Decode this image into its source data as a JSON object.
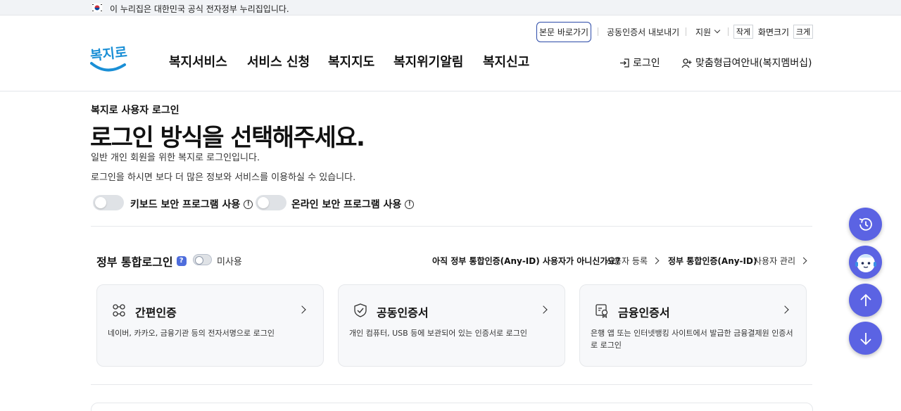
{
  "gov_bar": {
    "text": "이 누리집은 대한민국 공식 전자정부 누리집입니다."
  },
  "util": {
    "skip_label": "본문 바로가기",
    "cert_label": "공동인증서 내보내기",
    "support_label": "지원",
    "font_small": "작게",
    "font_size_label": "화면크기",
    "font_big": "크게"
  },
  "logo": {
    "text": "복지로"
  },
  "nav": [
    "복지서비스",
    "서비스 신청",
    "복지지도",
    "복지위기알림",
    "복지신고"
  ],
  "header_actions": {
    "login": "로그인",
    "member": "맞춤형급여안내(복지멤버십)"
  },
  "page": {
    "crumb": "복지로 사용자 로그인",
    "title": "로그인 방식을 선택해주세요.",
    "desc1": "일반 개인 회원을 위한 복지로 로그인입니다.",
    "desc2": "로그인을 하시면 보다 더 많은 정보와 서비스를 이용하실 수 있습니다."
  },
  "toggles": [
    {
      "label": "키보드 보안 프로그램 사용"
    },
    {
      "label": "온라인 보안 프로그램 사용"
    }
  ],
  "gov_login": {
    "title": "정부 통합로그인",
    "help": "?",
    "toggle_state": "미사용",
    "question": "아직 정부 통합인증(Any-ID) 사용자가 아니신가요?",
    "register": "사용자 등록",
    "any_id": "정부 통합인증(Any-ID)",
    "manage": "사용자 관리"
  },
  "cards": [
    {
      "icon": "simple-auth-icon",
      "title": "간편인증",
      "desc": "네이버, 카카오, 금융기관 등의 전자서명으로 로그인"
    },
    {
      "icon": "shield-check-icon",
      "title": "공동인증서",
      "desc": "개인 컴퓨터, USB 등에 보관되어 있는 인증서로 로그인"
    },
    {
      "icon": "financial-cert-icon",
      "title": "금융인증서",
      "desc": "은행 앱 또는 인터넷뱅킹 사이트에서 발급한 금융결제원 인증서로 로그인"
    }
  ],
  "floating": [
    "history-icon",
    "chatbot-icon",
    "arrow-up-icon",
    "arrow-down-icon"
  ],
  "colors": {
    "accent": "#5b63e3",
    "brand_blue": "#1a8fd6",
    "link_border": "#2b4aa8"
  }
}
